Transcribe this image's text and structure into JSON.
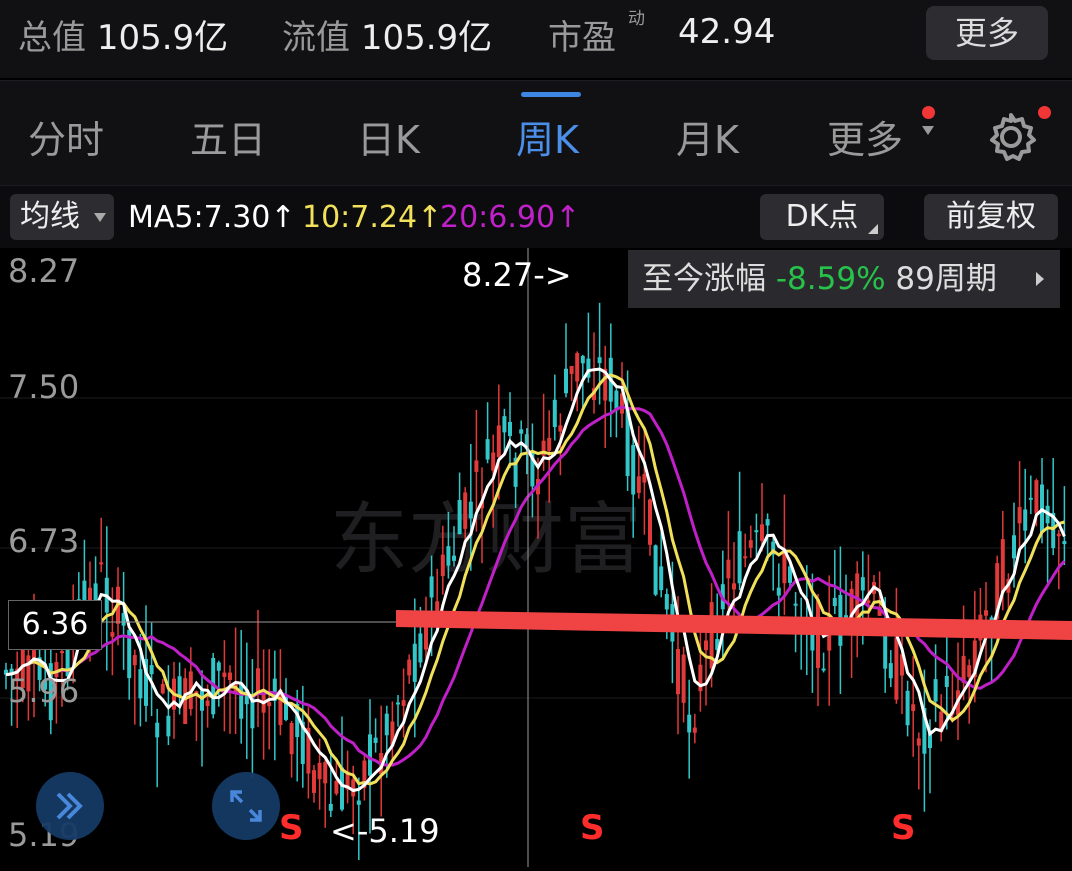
{
  "header": {
    "total_value_label": "总值",
    "total_value": "105.9亿",
    "float_value_label": "流值",
    "float_value": "105.9亿",
    "pe_label": "市盈",
    "pe_mark": "动",
    "pe_value": "42.94",
    "more_button": "更多"
  },
  "tabs": [
    {
      "label": "分时"
    },
    {
      "label": "五日"
    },
    {
      "label": "日K"
    },
    {
      "label": "周K",
      "active": true
    },
    {
      "label": "月K"
    },
    {
      "label": "更多"
    }
  ],
  "ma_bar": {
    "ma_button": "均线",
    "ma5": "MA5:7.30↑",
    "ma10": "10:7.24↑",
    "ma20": "20:6.90↑",
    "dk_button": "DK点",
    "adjust_button": "前复权"
  },
  "colors": {
    "ma5": "#ffffff",
    "ma10": "#f0e05a",
    "ma20": "#c020c8",
    "up": "#e03a3a",
    "down": "#33c6c9",
    "active_tab": "#4b8fe8",
    "trendline": "#f04444",
    "gain": "#27c24a"
  },
  "chart": {
    "y_labels": [
      "8.27",
      "7.50",
      "6.73",
      "5.96",
      "5.19"
    ],
    "period_label": "至今涨幅",
    "period_change": "-8.59%",
    "period_count": "89周期",
    "crosshair_price": "6.36",
    "high_annotation": "8.27->",
    "low_annotation": "<-5.19",
    "signal": "S",
    "watermark": "东方财富"
  },
  "chart_data": {
    "type": "candlestick",
    "ylim": [
      5.19,
      8.27
    ],
    "series": [
      {
        "name": "MA5",
        "value": "7.30"
      },
      {
        "name": "10",
        "value": "7.24"
      },
      {
        "name": "20",
        "value": "6.90"
      }
    ]
  },
  "icons": {
    "settings": "gear-icon",
    "expand_left": "double-chevron-icon",
    "expand_right": "expand-arrows-icon"
  }
}
